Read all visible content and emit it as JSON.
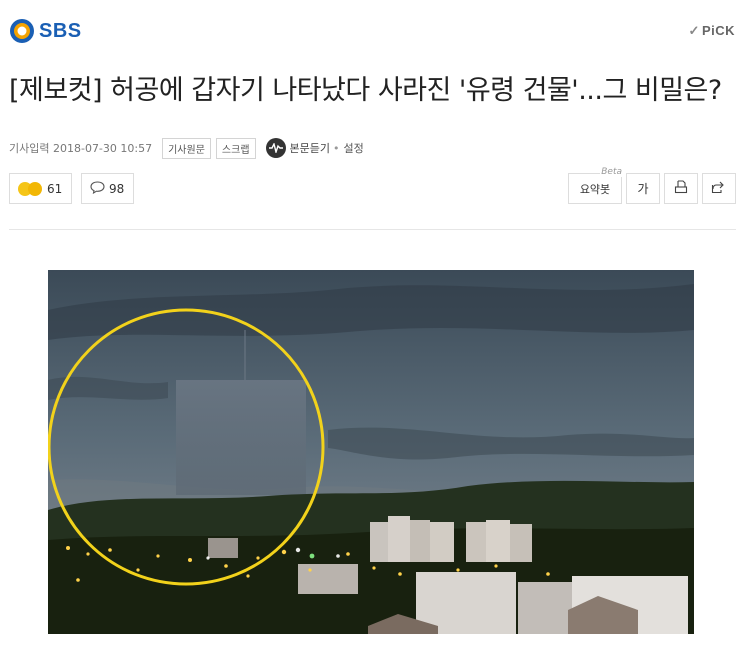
{
  "brand": {
    "name": "SBS",
    "pick_label": "PiCK"
  },
  "article": {
    "title": "[제보컷] 허공에 갑자기 나타났다 사라진 '유령 건물'...그 비밀은?",
    "date_label": "기사입력 2018-07-30 10:57",
    "original_label": "기사원문",
    "scrap_label": "스크랩",
    "listen_label": "본문듣기",
    "settings_label": "설정",
    "separator": "•"
  },
  "reactions": {
    "like_count": "61",
    "comment_count": "98"
  },
  "toolbar": {
    "summary_label": "요약봇",
    "beta_label": "Beta",
    "font_label": "가"
  },
  "icons": [
    "sbs-logo-icon",
    "check-icon",
    "listen-icon",
    "reaction-emoji-icon",
    "comment-icon",
    "print-icon",
    "share-icon"
  ],
  "colors": {
    "brand_blue": "#1a5fb4",
    "circle_yellow": "#f2d21b"
  }
}
